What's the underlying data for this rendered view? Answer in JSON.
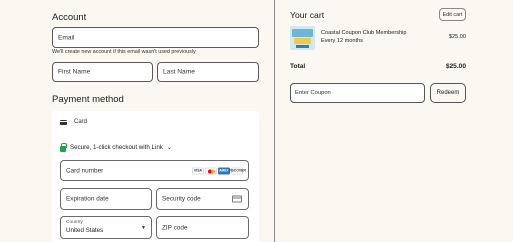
{
  "account": {
    "title": "Account",
    "email_placeholder": "Email",
    "email_hint": "We'll create new account if this email wasn't used previously",
    "first_name_placeholder": "First Name",
    "last_name_placeholder": "Last Name"
  },
  "payment": {
    "title": "Payment method",
    "card_label": "Card",
    "link_label": "Secure, 1-click checkout with Link",
    "card_number_placeholder": "Card number",
    "brands": [
      "VISA",
      "MC",
      "AMEX",
      "DISCOVER"
    ],
    "expiration_placeholder": "Expiration date",
    "security_code_placeholder": "Security code",
    "country_label": "Country",
    "country_value": "United States",
    "zip_placeholder": "ZIP code"
  },
  "cart": {
    "title": "Your cart",
    "edit_label": "Edit cart",
    "item_name": "Coastal Coupon Club Membership",
    "item_period": "Every 12 months",
    "item_price": "$25.00",
    "total_label": "Total",
    "total_value": "$25.00",
    "coupon_placeholder": "Enter Coupon",
    "redeem_label": "Redeem"
  },
  "colors": {
    "background": "#fbf8f1",
    "field_border": "#5a5a5a",
    "link_green": "#1fa34a"
  }
}
